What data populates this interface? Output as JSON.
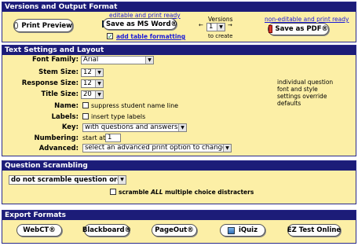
{
  "versions_section": {
    "title": "Versions and Output Format",
    "print_preview": "Print Preview",
    "editable_caption": "editable and print ready",
    "save_word": "Save as MS Word®",
    "add_table": "add table formatting",
    "versions_label": "Versions",
    "versions_value": "1",
    "to_create": "to create",
    "noneditable_caption": "non-editable and print ready",
    "save_pdf": "Save as PDF®"
  },
  "text_section": {
    "title": "Text Settings and Layout",
    "font_family_label": "Font Family:",
    "font_family_value": "Arial",
    "stem_size_label": "Stem Size:",
    "stem_size_value": "12",
    "response_size_label": "Response Size:",
    "response_size_value": "12",
    "title_size_label": "Title Size:",
    "title_size_value": "20",
    "name_label": "Name:",
    "name_option": "suppress student name line",
    "labels_label": "Labels:",
    "labels_option": "insert type labels",
    "key_label": "Key:",
    "key_value": "with questions and answers",
    "numbering_label": "Numbering:",
    "numbering_prefix": "start at",
    "numbering_value": "1",
    "advanced_label": "Advanced:",
    "advanced_value": "select an advanced print option to change",
    "note": "individual question font and style settings override defaults"
  },
  "scramble_section": {
    "title": "Question Scrambling",
    "order_value": "do not scramble question order",
    "distracters_prefix": "scramble ",
    "distracters_all": "ALL",
    "distracters_suffix": " multiple choice distracters"
  },
  "export_section": {
    "title": "Export Formats",
    "webct": "WebCT®",
    "blackboard": "Blackboard®",
    "pageout": "PageOut®",
    "iquiz": "iQuiz",
    "eztest": "EZ Test Online"
  }
}
